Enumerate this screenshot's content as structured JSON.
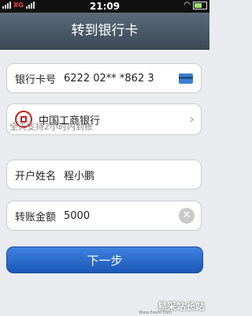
{
  "status": {
    "time": "21:09",
    "carrier_tag": "XG"
  },
  "header": {
    "title": "转到银行卡"
  },
  "card_field": {
    "label": "银行卡号",
    "value": "6222 02** *862 3"
  },
  "bank_field": {
    "value": "中国工商银行"
  },
  "hint": "全天支持2小时内到账",
  "name_field": {
    "label": "开户姓名",
    "value": "程小鹏"
  },
  "amount_field": {
    "label": "转账金额",
    "value": "5000"
  },
  "next_button": {
    "label": "下一步"
  },
  "watermark": {
    "text": "易采站长站",
    "sub": "Www.Easck.Com"
  },
  "colors": {
    "accent": "#2a6ad0",
    "title_bar": "#4a5968"
  }
}
